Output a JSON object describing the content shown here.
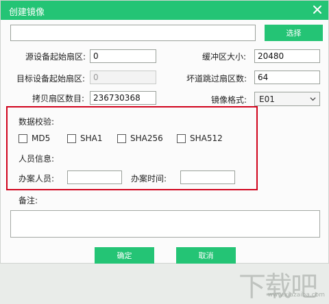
{
  "dialog": {
    "title": "创建镜像",
    "browse_label": "选择"
  },
  "fields": {
    "source_start_label": "源设备起始扇区:",
    "source_start_value": "0",
    "buffer_label": "缓冲区大小:",
    "buffer_value": "20480",
    "target_start_label": "目标设备起始扇区:",
    "target_start_value": "0",
    "bad_sector_label": "坏道跳过扇区数:",
    "bad_sector_value": "64",
    "copy_count_label": "拷贝扇区数目:",
    "copy_count_value": "236730368",
    "format_label": "镜像格式:",
    "format_value": "E01"
  },
  "verify": {
    "title": "数据校验:",
    "options": [
      "MD5",
      "SHA1",
      "SHA256",
      "SHA512"
    ]
  },
  "person": {
    "title": "人员信息:",
    "handler_label": "办案人员:",
    "time_label": "办案时间:"
  },
  "notes": {
    "label": "备注:"
  },
  "actions": {
    "ok_label": "确定",
    "cancel_label": "取消"
  },
  "watermark": {
    "text": "下载吧",
    "url": "www.xiazaiba.com"
  }
}
